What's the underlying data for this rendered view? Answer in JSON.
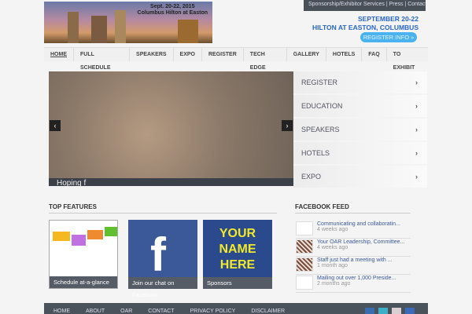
{
  "header": {
    "banner_line1": "Sept. 20-22, 2015",
    "banner_line2": "Columbus Hilton at Easton",
    "top_links": "Sponsorship/Exhibitor Services | Press | Contact",
    "date": "SEPTEMBER 20-22",
    "venue": "HILTON AT EASTON, COLUMBUS",
    "register_button": "REGISTER INFO »"
  },
  "nav": [
    "HOME",
    "FULL SCHEDULE",
    "SPEAKERS",
    "EXPO",
    "REGISTER",
    "TECH EDGE",
    "GALLERY",
    "HOTELS",
    "FAQ",
    "TO EXHIBIT"
  ],
  "slider": {
    "caption": "Hoping f",
    "prev": "‹",
    "next": "›"
  },
  "side_menu": [
    "REGISTER",
    "EDUCATION",
    "SPEAKERS",
    "HOTELS",
    "EXPO"
  ],
  "features": {
    "title": "TOP FEATURES",
    "items": [
      "Schedule at-a-glance",
      "Join our chat on Facebook",
      "Sponsors"
    ],
    "sponsor_art": "YOUR NAME HERE"
  },
  "facebook_feed": {
    "title": "FACEBOOK FEED",
    "items": [
      {
        "text": "Communicating and collaboratin...",
        "time": "4 weeks ago"
      },
      {
        "text": "Your OAR Leadership, Committee...",
        "time": "4 weeks ago"
      },
      {
        "text": "Staff just had a meeting with ...",
        "time": "1 month ago"
      },
      {
        "text": "Mailing out over 1,000 Preside...",
        "time": "2 months ago"
      }
    ]
  },
  "footer": [
    "HOME",
    "ABOUT",
    "OAR",
    "CONTACT",
    "PRIVACY POLICY",
    "DISCLAIMER"
  ]
}
